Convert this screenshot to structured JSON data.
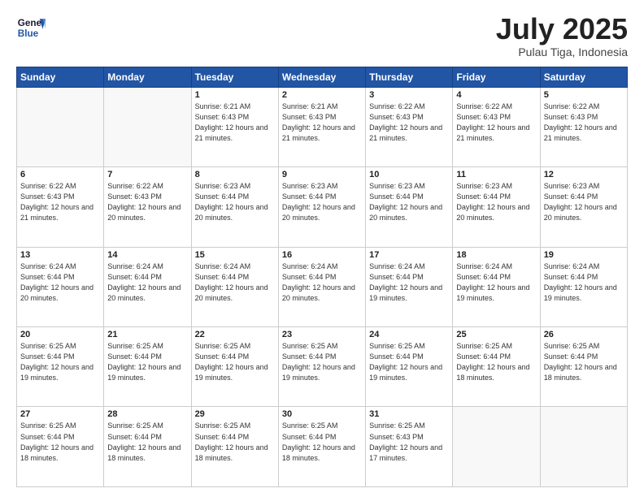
{
  "header": {
    "logo_line1": "General",
    "logo_line2": "Blue",
    "month": "July 2025",
    "location": "Pulau Tiga, Indonesia"
  },
  "weekdays": [
    "Sunday",
    "Monday",
    "Tuesday",
    "Wednesday",
    "Thursday",
    "Friday",
    "Saturday"
  ],
  "weeks": [
    [
      {
        "day": "",
        "sunrise": "",
        "sunset": "",
        "daylight": ""
      },
      {
        "day": "",
        "sunrise": "",
        "sunset": "",
        "daylight": ""
      },
      {
        "day": "1",
        "sunrise": "Sunrise: 6:21 AM",
        "sunset": "Sunset: 6:43 PM",
        "daylight": "Daylight: 12 hours and 21 minutes."
      },
      {
        "day": "2",
        "sunrise": "Sunrise: 6:21 AM",
        "sunset": "Sunset: 6:43 PM",
        "daylight": "Daylight: 12 hours and 21 minutes."
      },
      {
        "day": "3",
        "sunrise": "Sunrise: 6:22 AM",
        "sunset": "Sunset: 6:43 PM",
        "daylight": "Daylight: 12 hours and 21 minutes."
      },
      {
        "day": "4",
        "sunrise": "Sunrise: 6:22 AM",
        "sunset": "Sunset: 6:43 PM",
        "daylight": "Daylight: 12 hours and 21 minutes."
      },
      {
        "day": "5",
        "sunrise": "Sunrise: 6:22 AM",
        "sunset": "Sunset: 6:43 PM",
        "daylight": "Daylight: 12 hours and 21 minutes."
      }
    ],
    [
      {
        "day": "6",
        "sunrise": "Sunrise: 6:22 AM",
        "sunset": "Sunset: 6:43 PM",
        "daylight": "Daylight: 12 hours and 21 minutes."
      },
      {
        "day": "7",
        "sunrise": "Sunrise: 6:22 AM",
        "sunset": "Sunset: 6:43 PM",
        "daylight": "Daylight: 12 hours and 20 minutes."
      },
      {
        "day": "8",
        "sunrise": "Sunrise: 6:23 AM",
        "sunset": "Sunset: 6:44 PM",
        "daylight": "Daylight: 12 hours and 20 minutes."
      },
      {
        "day": "9",
        "sunrise": "Sunrise: 6:23 AM",
        "sunset": "Sunset: 6:44 PM",
        "daylight": "Daylight: 12 hours and 20 minutes."
      },
      {
        "day": "10",
        "sunrise": "Sunrise: 6:23 AM",
        "sunset": "Sunset: 6:44 PM",
        "daylight": "Daylight: 12 hours and 20 minutes."
      },
      {
        "day": "11",
        "sunrise": "Sunrise: 6:23 AM",
        "sunset": "Sunset: 6:44 PM",
        "daylight": "Daylight: 12 hours and 20 minutes."
      },
      {
        "day": "12",
        "sunrise": "Sunrise: 6:23 AM",
        "sunset": "Sunset: 6:44 PM",
        "daylight": "Daylight: 12 hours and 20 minutes."
      }
    ],
    [
      {
        "day": "13",
        "sunrise": "Sunrise: 6:24 AM",
        "sunset": "Sunset: 6:44 PM",
        "daylight": "Daylight: 12 hours and 20 minutes."
      },
      {
        "day": "14",
        "sunrise": "Sunrise: 6:24 AM",
        "sunset": "Sunset: 6:44 PM",
        "daylight": "Daylight: 12 hours and 20 minutes."
      },
      {
        "day": "15",
        "sunrise": "Sunrise: 6:24 AM",
        "sunset": "Sunset: 6:44 PM",
        "daylight": "Daylight: 12 hours and 20 minutes."
      },
      {
        "day": "16",
        "sunrise": "Sunrise: 6:24 AM",
        "sunset": "Sunset: 6:44 PM",
        "daylight": "Daylight: 12 hours and 20 minutes."
      },
      {
        "day": "17",
        "sunrise": "Sunrise: 6:24 AM",
        "sunset": "Sunset: 6:44 PM",
        "daylight": "Daylight: 12 hours and 19 minutes."
      },
      {
        "day": "18",
        "sunrise": "Sunrise: 6:24 AM",
        "sunset": "Sunset: 6:44 PM",
        "daylight": "Daylight: 12 hours and 19 minutes."
      },
      {
        "day": "19",
        "sunrise": "Sunrise: 6:24 AM",
        "sunset": "Sunset: 6:44 PM",
        "daylight": "Daylight: 12 hours and 19 minutes."
      }
    ],
    [
      {
        "day": "20",
        "sunrise": "Sunrise: 6:25 AM",
        "sunset": "Sunset: 6:44 PM",
        "daylight": "Daylight: 12 hours and 19 minutes."
      },
      {
        "day": "21",
        "sunrise": "Sunrise: 6:25 AM",
        "sunset": "Sunset: 6:44 PM",
        "daylight": "Daylight: 12 hours and 19 minutes."
      },
      {
        "day": "22",
        "sunrise": "Sunrise: 6:25 AM",
        "sunset": "Sunset: 6:44 PM",
        "daylight": "Daylight: 12 hours and 19 minutes."
      },
      {
        "day": "23",
        "sunrise": "Sunrise: 6:25 AM",
        "sunset": "Sunset: 6:44 PM",
        "daylight": "Daylight: 12 hours and 19 minutes."
      },
      {
        "day": "24",
        "sunrise": "Sunrise: 6:25 AM",
        "sunset": "Sunset: 6:44 PM",
        "daylight": "Daylight: 12 hours and 19 minutes."
      },
      {
        "day": "25",
        "sunrise": "Sunrise: 6:25 AM",
        "sunset": "Sunset: 6:44 PM",
        "daylight": "Daylight: 12 hours and 18 minutes."
      },
      {
        "day": "26",
        "sunrise": "Sunrise: 6:25 AM",
        "sunset": "Sunset: 6:44 PM",
        "daylight": "Daylight: 12 hours and 18 minutes."
      }
    ],
    [
      {
        "day": "27",
        "sunrise": "Sunrise: 6:25 AM",
        "sunset": "Sunset: 6:44 PM",
        "daylight": "Daylight: 12 hours and 18 minutes."
      },
      {
        "day": "28",
        "sunrise": "Sunrise: 6:25 AM",
        "sunset": "Sunset: 6:44 PM",
        "daylight": "Daylight: 12 hours and 18 minutes."
      },
      {
        "day": "29",
        "sunrise": "Sunrise: 6:25 AM",
        "sunset": "Sunset: 6:44 PM",
        "daylight": "Daylight: 12 hours and 18 minutes."
      },
      {
        "day": "30",
        "sunrise": "Sunrise: 6:25 AM",
        "sunset": "Sunset: 6:44 PM",
        "daylight": "Daylight: 12 hours and 18 minutes."
      },
      {
        "day": "31",
        "sunrise": "Sunrise: 6:25 AM",
        "sunset": "Sunset: 6:43 PM",
        "daylight": "Daylight: 12 hours and 17 minutes."
      },
      {
        "day": "",
        "sunrise": "",
        "sunset": "",
        "daylight": ""
      },
      {
        "day": "",
        "sunrise": "",
        "sunset": "",
        "daylight": ""
      }
    ]
  ]
}
